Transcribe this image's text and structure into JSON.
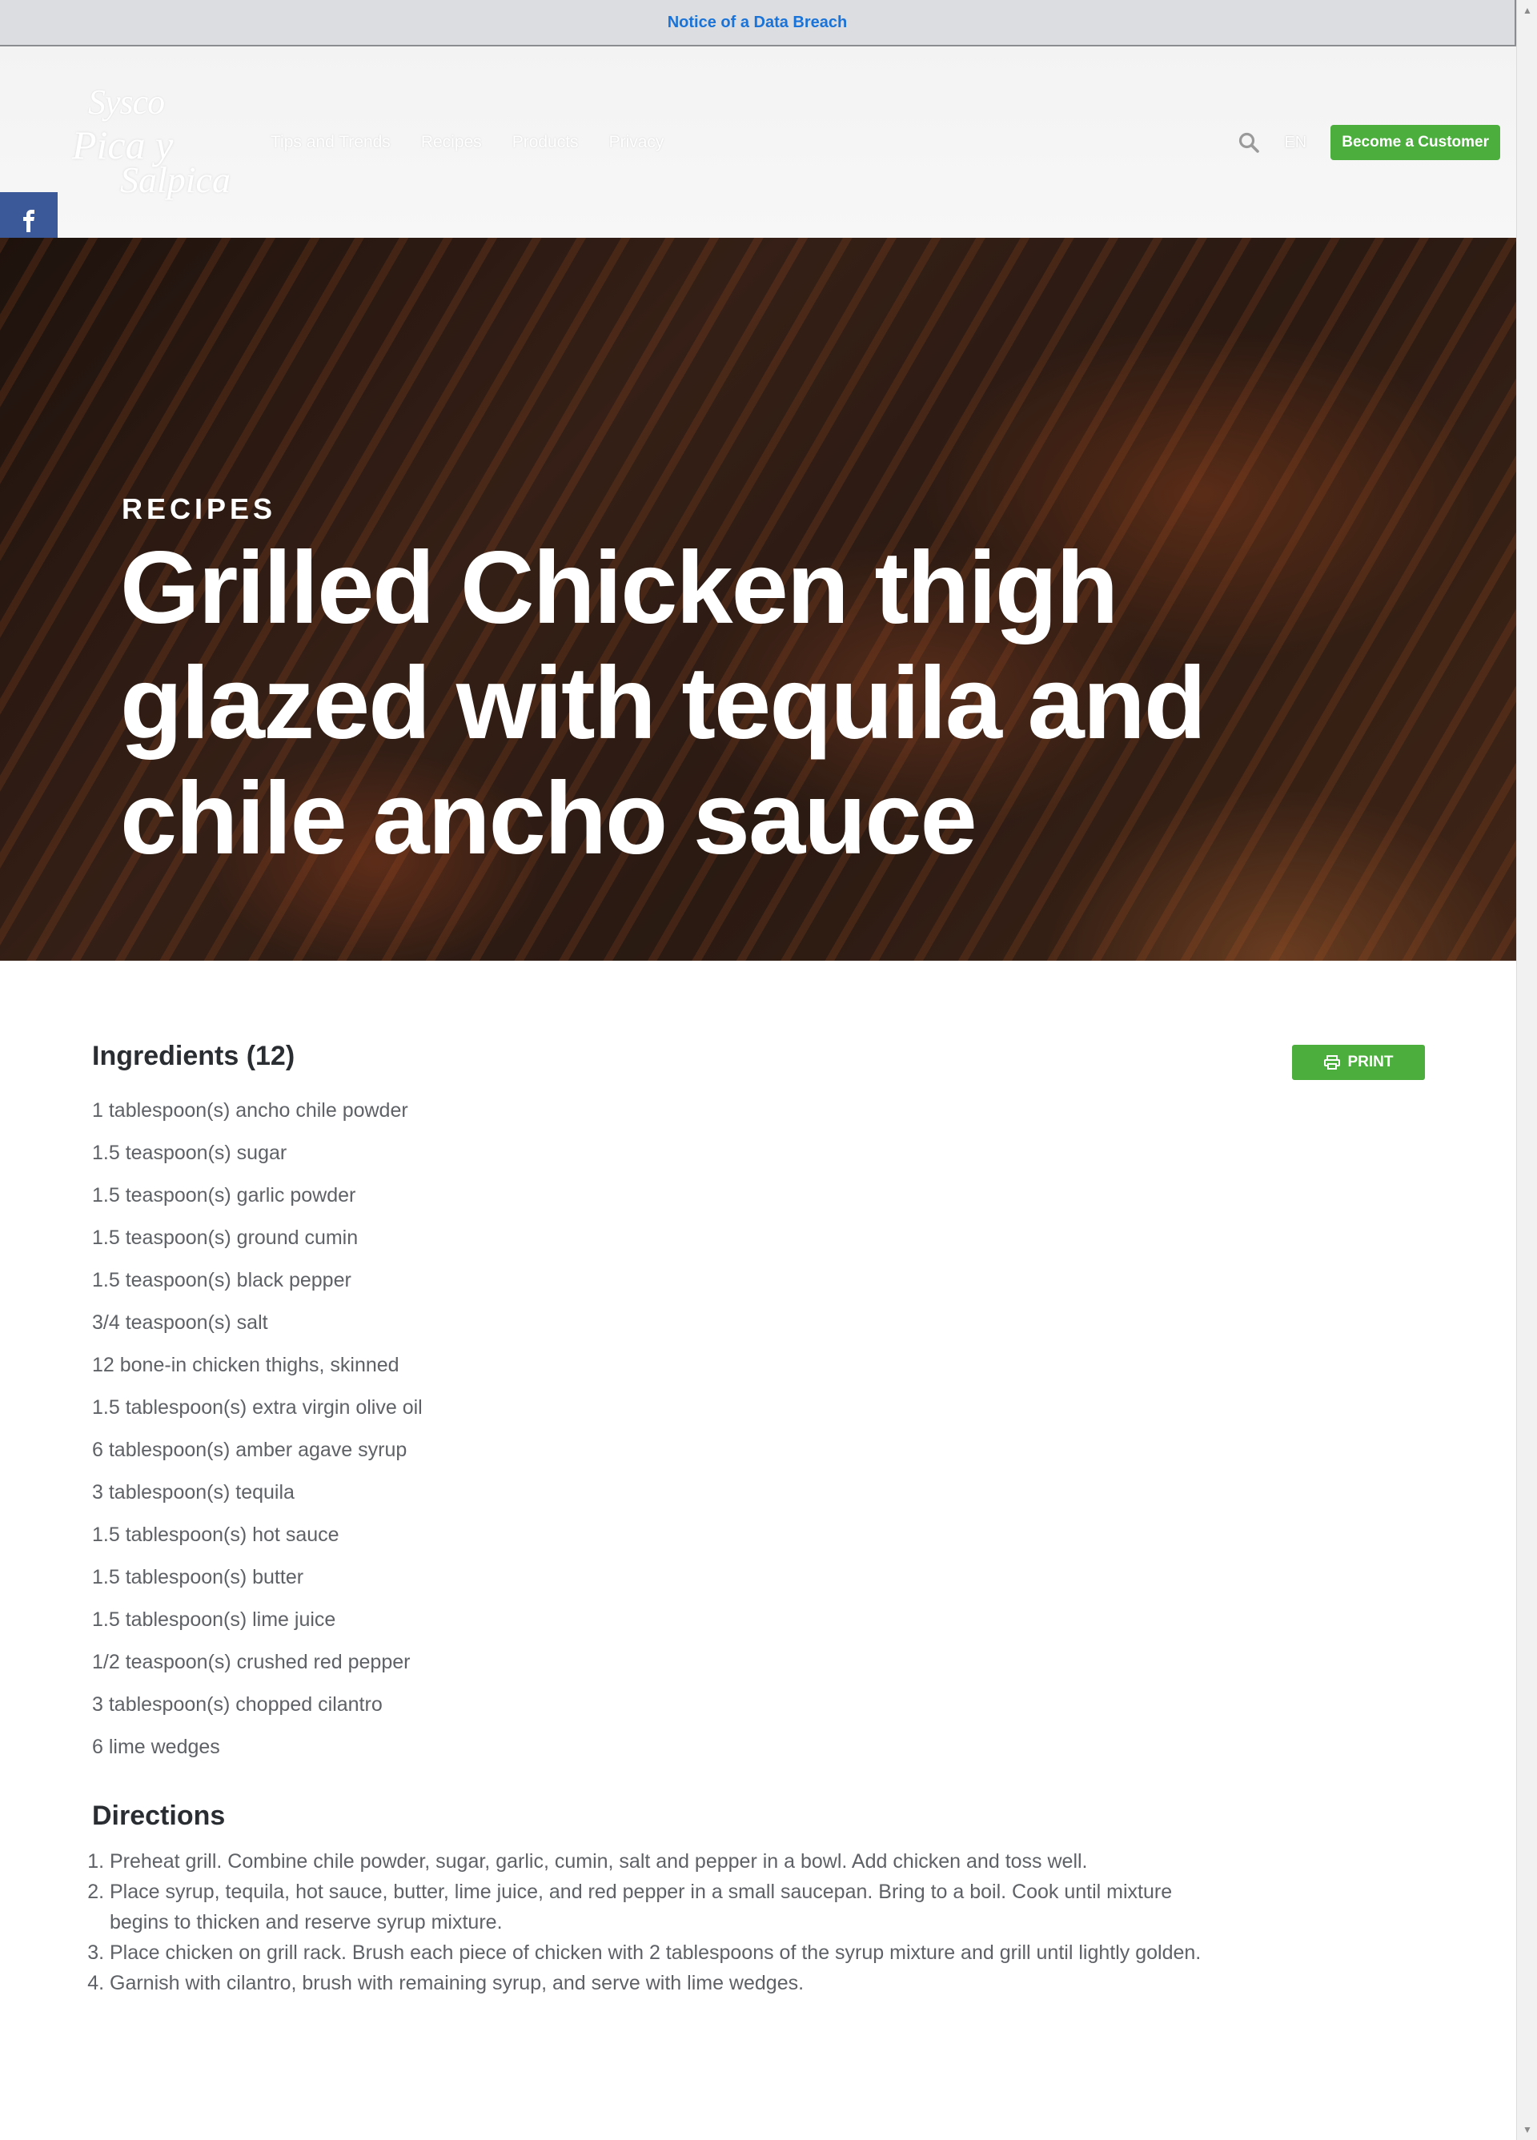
{
  "notice": {
    "text": "Notice of a Data Breach"
  },
  "header": {
    "logo": {
      "brand": "Sysco",
      "script_line1": "Pica y",
      "script_line2": "Salpica"
    },
    "nav": [
      "Tips and Trends",
      "Recipes",
      "Products",
      "Privacy"
    ],
    "language": "EN",
    "cta_label": "Become a Customer"
  },
  "social": [
    "facebook",
    "x",
    "pinterest",
    "email",
    "share"
  ],
  "hero": {
    "kicker": "RECIPES",
    "title": "Grilled Chicken thigh glazed with tequila and chile ancho sauce"
  },
  "ingredients": {
    "title": "Ingredients (12)",
    "print_label": "PRINT",
    "items": [
      "1 tablespoon(s) ancho chile powder",
      "1.5 teaspoon(s) sugar",
      "1.5 teaspoon(s) garlic powder",
      "1.5 teaspoon(s) ground cumin",
      "1.5 teaspoon(s) black pepper",
      "3/4 teaspoon(s) salt",
      "12 bone-in chicken thighs, skinned",
      "1.5 tablespoon(s) extra virgin olive oil",
      "6 tablespoon(s) amber agave syrup",
      "3 tablespoon(s) tequila",
      "1.5 tablespoon(s) hot sauce",
      "1.5 tablespoon(s) butter",
      "1.5 tablespoon(s) lime juice",
      "1/2 teaspoon(s) crushed red pepper",
      "3 tablespoon(s) chopped cilantro",
      "6 lime wedges"
    ]
  },
  "directions": {
    "title": "Directions",
    "steps": [
      "Preheat grill. Combine chile powder, sugar, garlic, cumin, salt and pepper in a bowl. Add chicken and toss well.",
      "Place syrup, tequila, hot sauce, butter, lime juice, and red pepper in a small saucepan. Bring to a boil. Cook until mixture begins to thicken and reserve syrup mixture.",
      "Place chicken on grill rack. Brush each piece of chicken with 2 tablespoons of the syrup mixture and grill until lightly golden.",
      "Garnish with cilantro, brush with remaining syrup, and serve with lime wedges."
    ]
  },
  "colors": {
    "accent_green": "#4bae3d",
    "link_blue": "#1a73d8",
    "facebook": "#3b5998",
    "pinterest": "#cb2027",
    "share": "#7dc242"
  }
}
